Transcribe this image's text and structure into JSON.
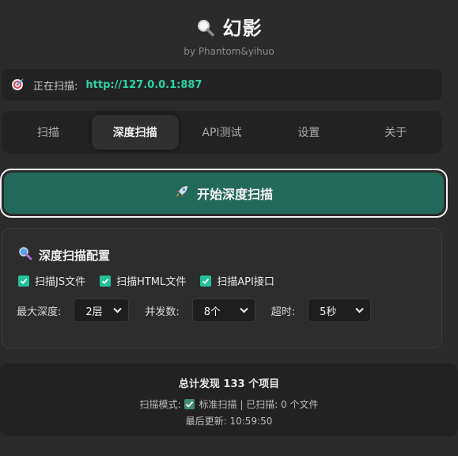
{
  "app": {
    "title": "幻影",
    "subtitle": "by Phantom&yihuo"
  },
  "status": {
    "label": "正在扫描:",
    "url": "http://127.0.0.1:887"
  },
  "tabs": [
    {
      "label": "扫描",
      "active": false
    },
    {
      "label": "深度扫描",
      "active": true
    },
    {
      "label": "API测试",
      "active": false
    },
    {
      "label": "设置",
      "active": false
    },
    {
      "label": "关于",
      "active": false
    }
  ],
  "start_button": {
    "label": "开始深度扫描",
    "icon": "rocket-icon"
  },
  "config": {
    "title": "深度扫描配置",
    "checkboxes": [
      {
        "label": "扫描JS文件",
        "checked": true
      },
      {
        "label": "扫描HTML文件",
        "checked": true
      },
      {
        "label": "扫描API接口",
        "checked": true
      }
    ],
    "max_depth": {
      "label": "最大深度:",
      "value": "2层"
    },
    "concurrency": {
      "label": "并发数:",
      "value": "8个"
    },
    "timeout": {
      "label": "超时:",
      "value": "5秒"
    }
  },
  "footer": {
    "total_prefix": "总计发现",
    "total_count": "133",
    "total_suffix": "个项目",
    "mode_label": "扫描模式:",
    "mode_value": "标准扫描 | 已扫描: 0 个文件",
    "updated": "最后更新: 10:59:50"
  },
  "colors": {
    "background": "#2b2b2b",
    "accent": "#2ed3a4",
    "start_button": "#23695a",
    "checkbox": "#22c29a"
  }
}
